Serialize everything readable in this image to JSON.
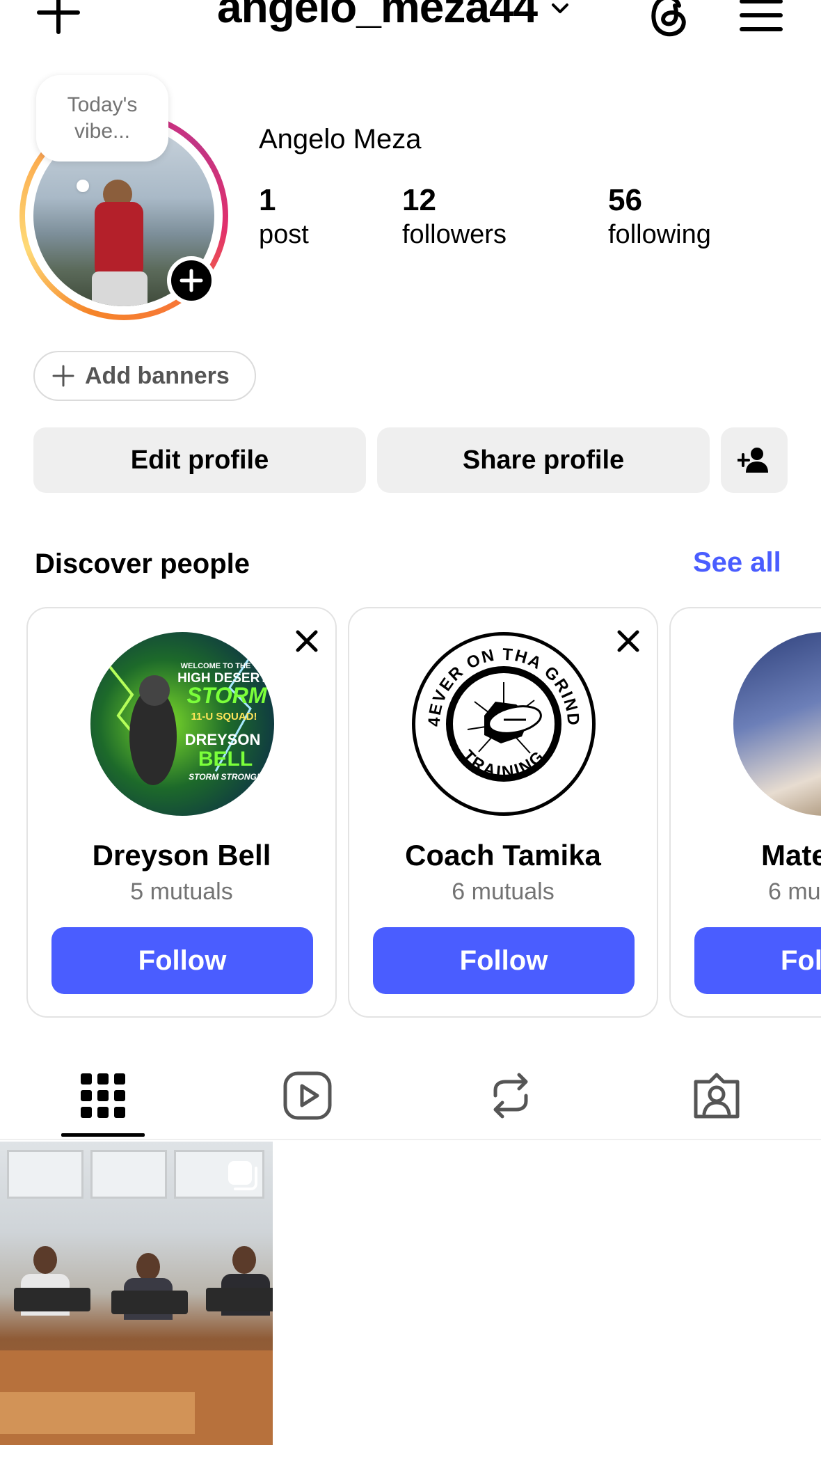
{
  "header": {
    "username": "angelo_meza44"
  },
  "profile": {
    "note": "Today's vibe...",
    "display_name": "Angelo Meza",
    "stats": [
      {
        "value": "1",
        "label": "post"
      },
      {
        "value": "12",
        "label": "followers"
      },
      {
        "value": "56",
        "label": "following"
      }
    ]
  },
  "actions": {
    "add_banners": "Add banners",
    "edit_profile": "Edit profile",
    "share_profile": "Share profile"
  },
  "discover": {
    "title": "Discover people",
    "see_all": "See all",
    "cards": [
      {
        "name": "Dreyson Bell",
        "mutuals": "5 mutuals",
        "follow": "Follow"
      },
      {
        "name": "Coach Tamika",
        "mutuals": "6 mutuals",
        "follow": "Follow"
      },
      {
        "name": "Mate",
        "mutuals": "6 mu",
        "follow": "Fol"
      }
    ]
  },
  "avatar_texts": {
    "card1_lines": [
      "WELCOME TO THE",
      "HIGH DESERT",
      "STORM",
      "11-U SQUAD!",
      "DREYSON",
      "BELL",
      "STORM STRONG!"
    ],
    "card2_top": "4EVER ON THA GRIND",
    "card2_bottom": "TRAINING"
  },
  "colors": {
    "accent": "#4a5dff",
    "button_bg": "#efefef",
    "muted_text": "#737373"
  },
  "icons": [
    "plus-icon",
    "chevron-down-icon",
    "threads-icon",
    "menu-icon",
    "add-person-icon",
    "close-icon",
    "grid-icon",
    "reels-icon",
    "reposts-icon",
    "tagged-icon",
    "multi-photo-icon"
  ]
}
